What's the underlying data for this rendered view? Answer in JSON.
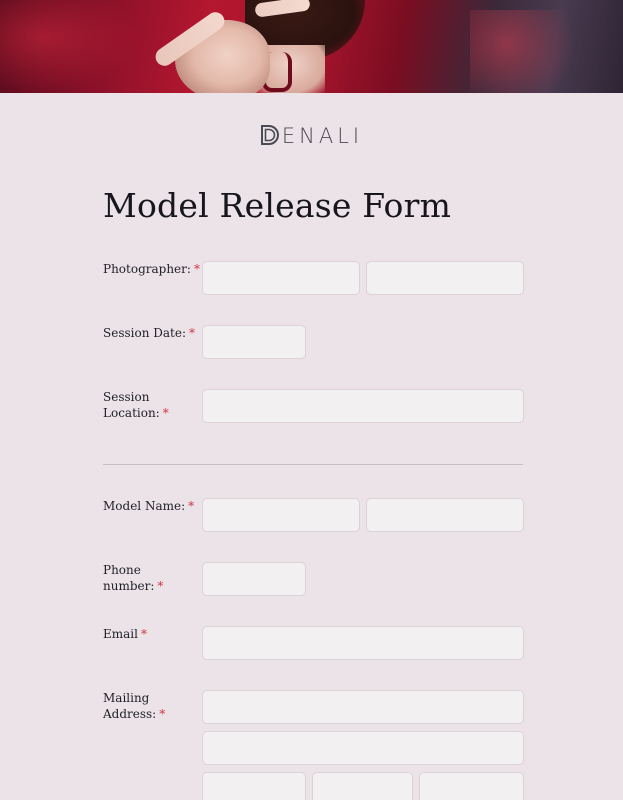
{
  "brand": {
    "name": "ENALI",
    "logo_icon": "denali-d-icon"
  },
  "form": {
    "title": "Model Release Form",
    "required_mark": "*",
    "photographer": {
      "label": "Photographer:",
      "first_value": "",
      "last_value": ""
    },
    "session_date": {
      "label": "Session Date:",
      "value": ""
    },
    "session_location": {
      "label_line1": "Session",
      "label_line2": "Location:",
      "value": ""
    },
    "model_name": {
      "label": "Model Name:",
      "first_value": "",
      "last_value": ""
    },
    "phone": {
      "label_line1": "Phone",
      "label_line2": "number:",
      "value": ""
    },
    "email": {
      "label": "Email",
      "value": ""
    },
    "mailing_address": {
      "label_line1": "Mailing",
      "label_line2": "Address:",
      "line1_value": "",
      "line2_value": "",
      "city_value": "",
      "state_value": "",
      "zip_value": ""
    }
  },
  "colors": {
    "background": "#ebe3e7",
    "field_background": "#f3f0f1",
    "required": "#d23645",
    "hero_accent": "#a8142c"
  }
}
